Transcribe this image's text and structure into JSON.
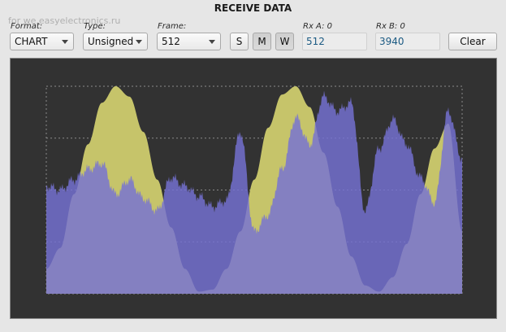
{
  "window": {
    "title": "RECEIVE DATA",
    "watermark": "for we.easyelectronics.ru"
  },
  "controls": {
    "format": {
      "label": "Format:",
      "value": "CHART"
    },
    "type": {
      "label": "Type:",
      "value": "Unsigned"
    },
    "frame": {
      "label": "Frame:",
      "value": "512"
    },
    "buttons": {
      "s": "S",
      "m": "M",
      "w": "W",
      "clear": "Clear"
    },
    "rx_a": {
      "label": "Rx A: 0",
      "value": "512"
    },
    "rx_b": {
      "label": "Rx B: 0",
      "value": "3940"
    }
  },
  "chart_data": {
    "type": "area",
    "title": "",
    "xlabel": "",
    "ylabel": "",
    "grid": true,
    "colors": {
      "background": "#323232",
      "series_a": "#c6c46a",
      "series_b": "#7572d4",
      "overlap": "#9896e0",
      "grid": "#8a8a8a"
    },
    "series": [
      {
        "values": [
          0.12,
          0.22,
          0.48,
          0.72,
          0.92,
          1.0,
          0.95,
          0.78,
          0.55,
          0.32,
          0.12,
          0.01,
          0.02,
          0.12,
          0.3,
          0.55,
          0.8,
          0.96,
          1.0,
          0.9,
          0.68,
          0.42,
          0.18,
          0.04,
          0.01,
          0.08,
          0.24,
          0.48,
          0.7,
          0.82,
          0.3
        ]
      },
      {
        "values": [
          0.52,
          0.5,
          0.55,
          0.6,
          0.63,
          0.48,
          0.55,
          0.46,
          0.4,
          0.56,
          0.52,
          0.47,
          0.42,
          0.45,
          0.78,
          0.3,
          0.38,
          0.6,
          0.85,
          0.72,
          0.95,
          0.88,
          0.92,
          0.4,
          0.7,
          0.84,
          0.72,
          0.56,
          0.44,
          0.88,
          0.65
        ]
      }
    ],
    "x_range": [
      0,
      511
    ],
    "y_range": [
      0,
      1
    ]
  }
}
